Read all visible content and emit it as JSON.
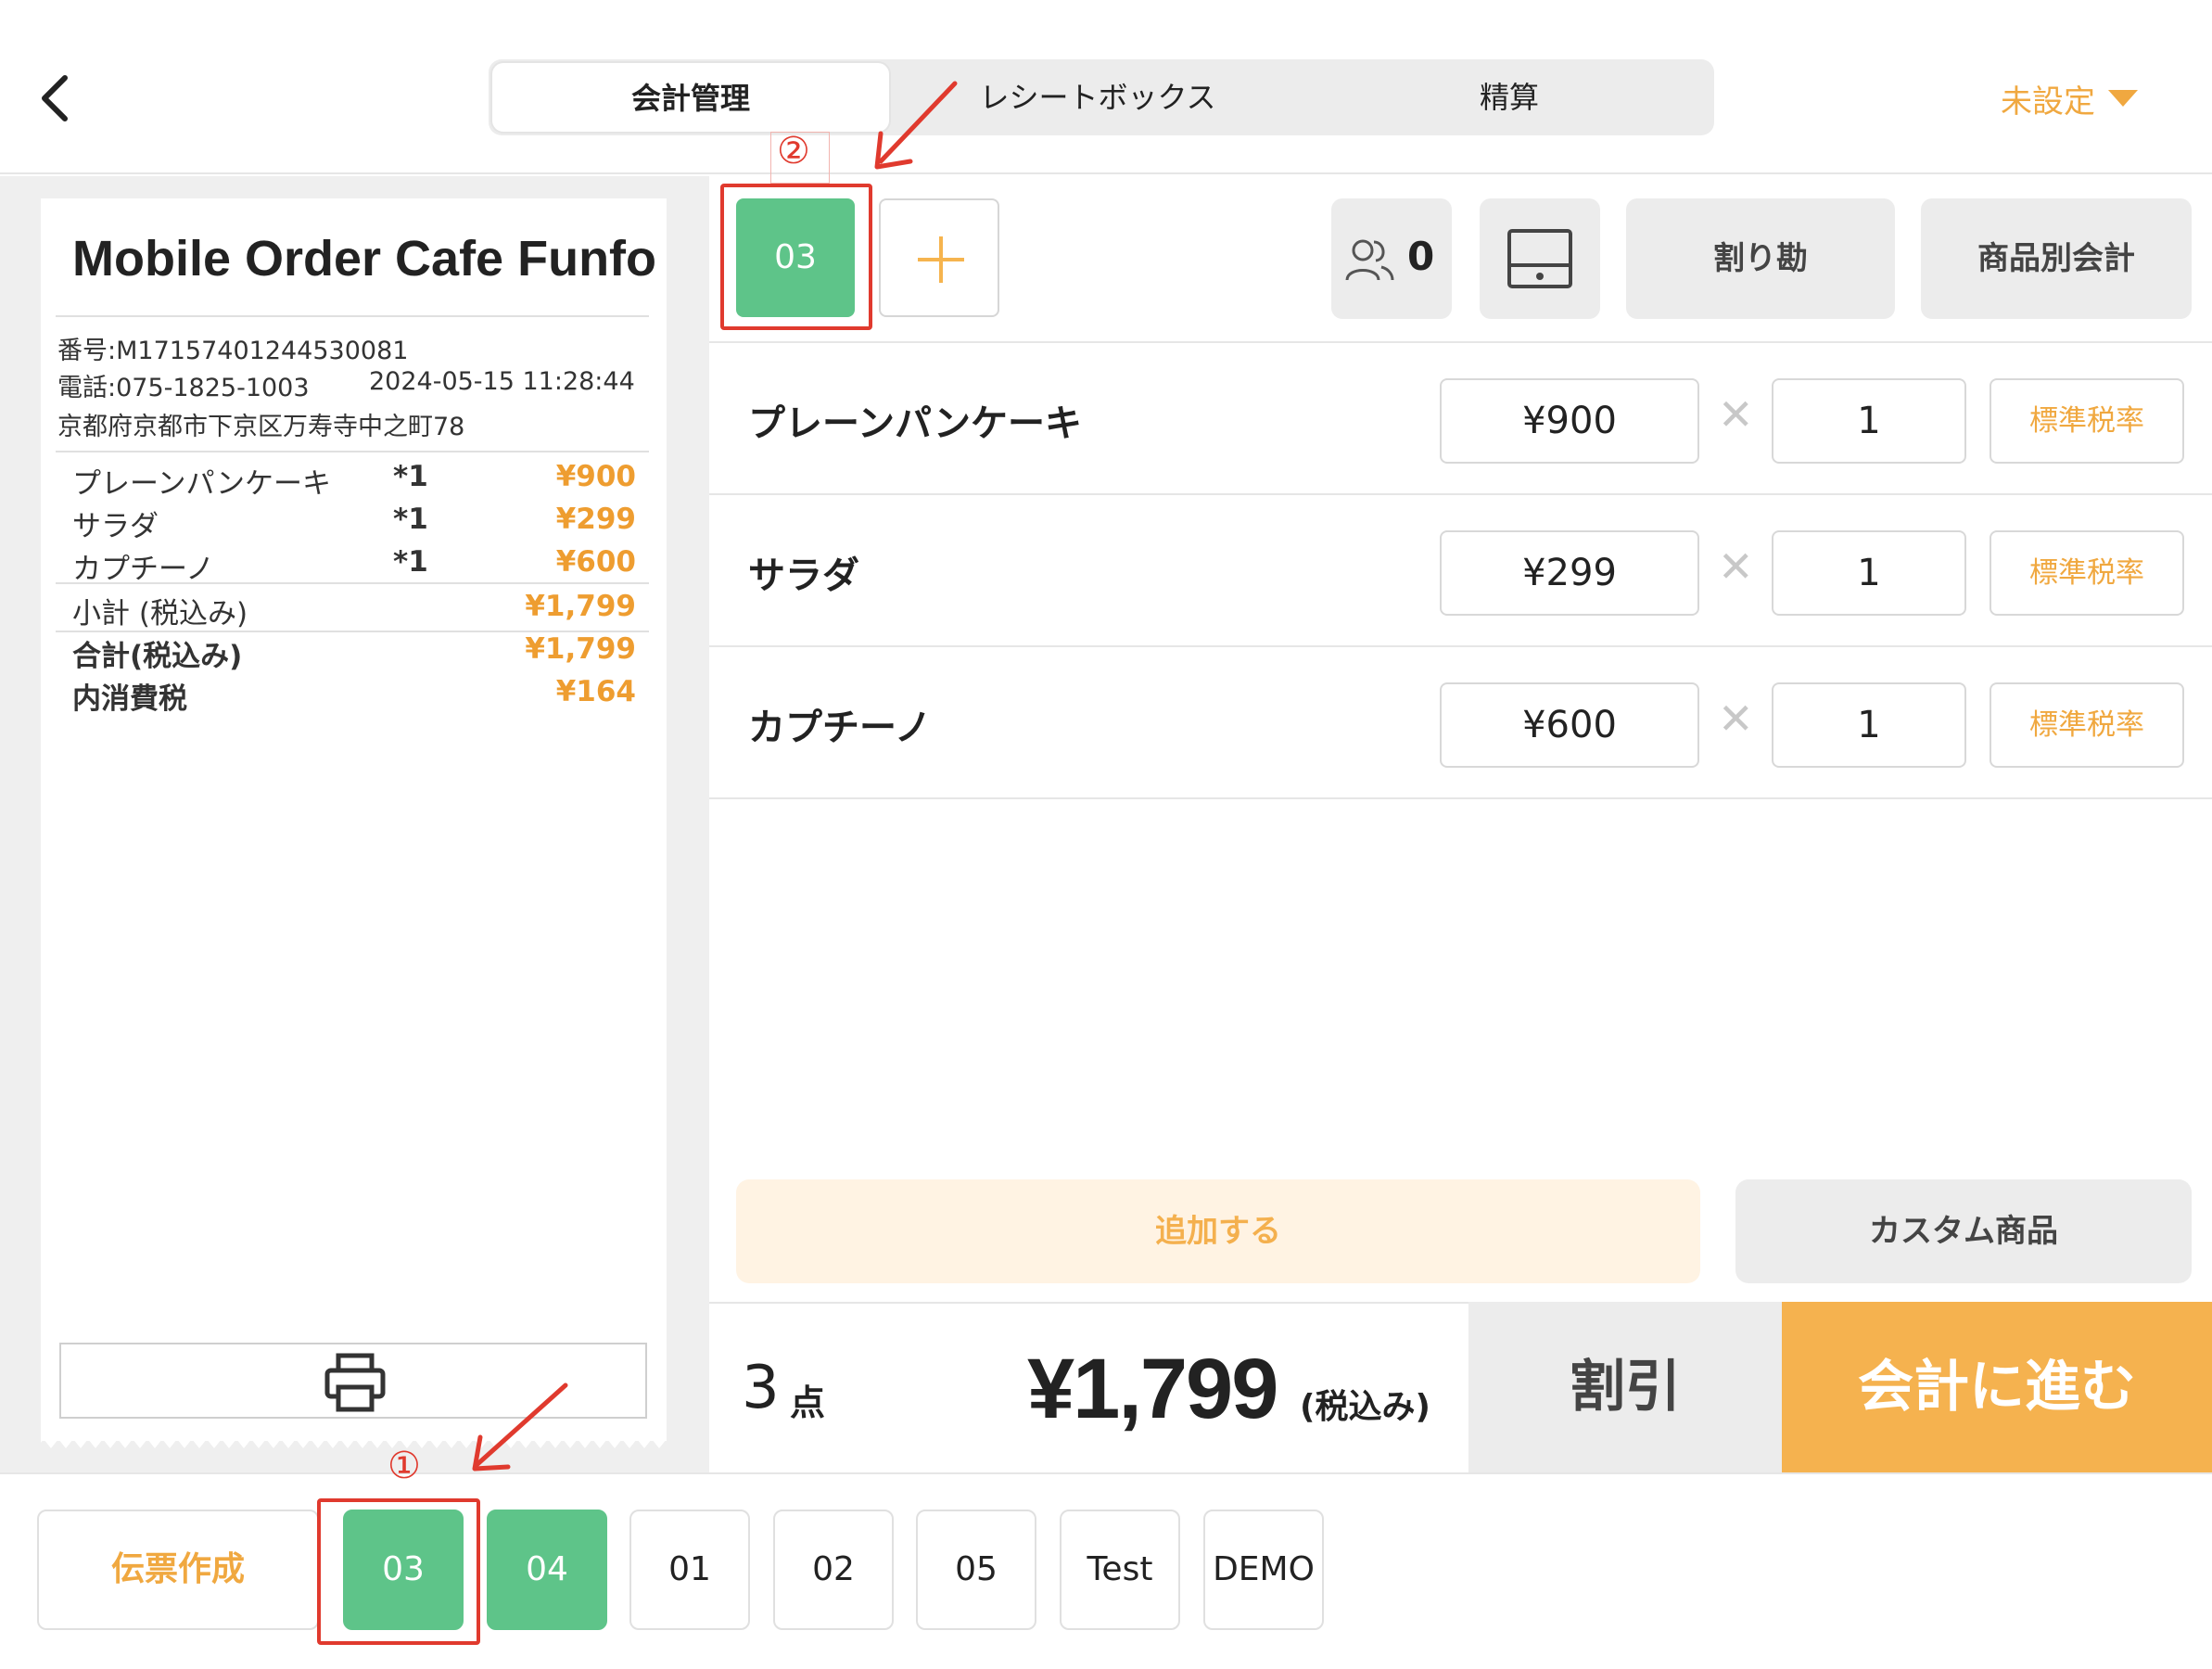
{
  "header": {
    "tabs": [
      "会計管理",
      "レシートボックス",
      "精算"
    ],
    "active_tab": 0,
    "setting_label": "未設定"
  },
  "receipt": {
    "shop_name": "Mobile Order Cafe Funfo",
    "number": "番号:M17157401244530081",
    "phone": "電話:075-1825-1003",
    "datetime": "2024-05-15 11:28:44",
    "address": "京都府京都市下京区万寿寺中之町78",
    "items": [
      {
        "name": "プレーンパンケーキ",
        "qty": "*1",
        "price": "¥900"
      },
      {
        "name": "サラダ",
        "qty": "*1",
        "price": "¥299"
      },
      {
        "name": "カプチーノ",
        "qty": "*1",
        "price": "¥600"
      }
    ],
    "subtotal_label": "小計 (税込み)",
    "subtotal": "¥1,799",
    "total_label": "合計(税込み)",
    "total": "¥1,799",
    "tax_label": "内消費税",
    "tax": "¥164"
  },
  "order": {
    "current_tab": "03",
    "people_count": "0",
    "split_label": "割り勘",
    "item_checkout_label": "商品別会計",
    "items": [
      {
        "name": "プレーンパンケーキ",
        "price": "¥900",
        "qty": "1",
        "tax": "標準税率"
      },
      {
        "name": "サラダ",
        "price": "¥299",
        "qty": "1",
        "tax": "標準税率"
      },
      {
        "name": "カプチーノ",
        "price": "¥600",
        "qty": "1",
        "tax": "標準税率"
      }
    ],
    "add_label": "追加する",
    "custom_label": "カスタム商品",
    "count": "3",
    "count_unit": "点",
    "total": "¥1,799",
    "total_tax_note": "(税込み)",
    "discount_label": "割引",
    "checkout_label": "会計に進む"
  },
  "bottom": {
    "slip_label": "伝票作成",
    "tables": [
      {
        "label": "03",
        "active": true
      },
      {
        "label": "04",
        "active": true
      },
      {
        "label": "01",
        "active": false
      },
      {
        "label": "02",
        "active": false
      },
      {
        "label": "05",
        "active": false
      },
      {
        "label": "Test",
        "active": false
      },
      {
        "label": "DEMO",
        "active": false
      }
    ]
  },
  "annotations": {
    "step1": "①",
    "step2": "②",
    "color": "#e03a2e"
  },
  "colors": {
    "accent_orange": "#f5b24f",
    "green": "#5ec489"
  }
}
